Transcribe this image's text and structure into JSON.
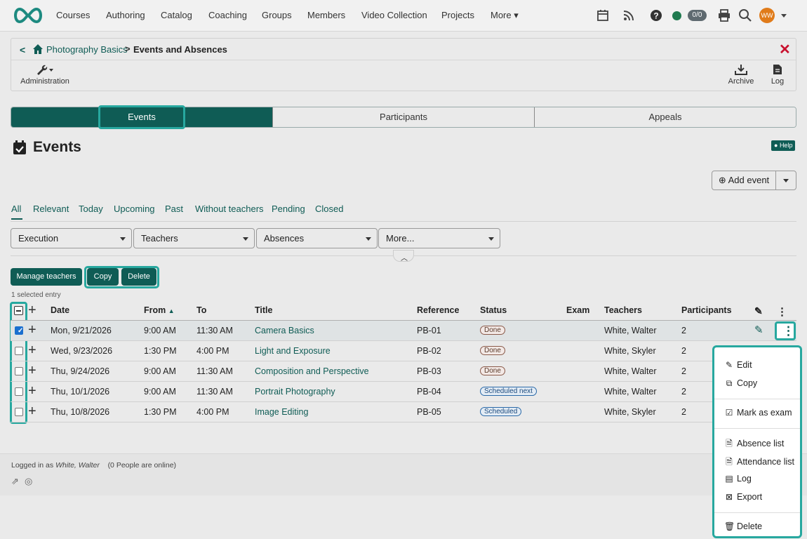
{
  "nav": {
    "items": [
      "Courses",
      "Authoring",
      "Catalog",
      "Coaching",
      "Groups",
      "Members",
      "Video Collection",
      "Projects",
      "More"
    ],
    "counter": "0/0",
    "avatar": "WW"
  },
  "breadcrumb": {
    "course": "Photography Basics",
    "sep": ">",
    "current": "Events and Absences"
  },
  "toolbar": {
    "admin_label": "Administration",
    "archive_label": "Archive",
    "log_label": "Log"
  },
  "tabs": [
    "Events",
    "Participants",
    "Appeals"
  ],
  "page": {
    "title": "Events",
    "help_label": "Help",
    "add_event_label": "Add event"
  },
  "filter_tabs": [
    "All",
    "Relevant",
    "Today",
    "Upcoming",
    "Past",
    "Without teachers",
    "Pending",
    "Closed"
  ],
  "dropdowns": [
    "Execution",
    "Teachers",
    "Absences",
    "More..."
  ],
  "actions": {
    "manage_teachers": "Manage teachers",
    "copy": "Copy",
    "delete": "Delete",
    "selected_text": "1 selected entry"
  },
  "table": {
    "headers": {
      "date": "Date",
      "from": "From",
      "to": "To",
      "title": "Title",
      "reference": "Reference",
      "status": "Status",
      "exam": "Exam",
      "teachers": "Teachers",
      "participants": "Participants"
    },
    "rows": [
      {
        "date": "Mon, 9/21/2026",
        "from": "9:00 AM",
        "to": "11:30 AM",
        "title": "Camera Basics",
        "reference": "PB-01",
        "status": "Done",
        "teachers": "White, Walter",
        "participants": "2",
        "selected": true
      },
      {
        "date": "Wed, 9/23/2026",
        "from": "1:30 PM",
        "to": "4:00 PM",
        "title": "Light and Exposure",
        "reference": "PB-02",
        "status": "Done",
        "teachers": "White, Skyler",
        "participants": "2",
        "selected": false
      },
      {
        "date": "Thu, 9/24/2026",
        "from": "9:00 AM",
        "to": "11:30 AM",
        "title": "Composition and Perspective",
        "reference": "PB-03",
        "status": "Done",
        "teachers": "White, Walter",
        "participants": "2",
        "selected": false
      },
      {
        "date": "Thu, 10/1/2026",
        "from": "9:00 AM",
        "to": "11:30 AM",
        "title": "Portrait Photography",
        "reference": "PB-04",
        "status": "Scheduled next",
        "teachers": "White, Walter",
        "participants": "2",
        "selected": false
      },
      {
        "date": "Thu, 10/8/2026",
        "from": "1:30 PM",
        "to": "4:00 PM",
        "title": "Image Editing",
        "reference": "PB-05",
        "status": "Scheduled",
        "teachers": "White, Skyler",
        "participants": "2",
        "selected": false
      }
    ]
  },
  "row_menu": {
    "edit": "Edit",
    "copy": "Copy",
    "mark_exam": "Mark as exam",
    "absence_list": "Absence list",
    "attendance_list": "Attendance list",
    "log": "Log",
    "export": "Export",
    "delete": "Delete"
  },
  "footer": {
    "logged_prefix": "Logged in as",
    "user": "White, Walter",
    "online": "(0 People are online)"
  },
  "colors": {
    "brand": "#0f5c55",
    "focus": "#27a89f",
    "close": "#c8102e"
  }
}
